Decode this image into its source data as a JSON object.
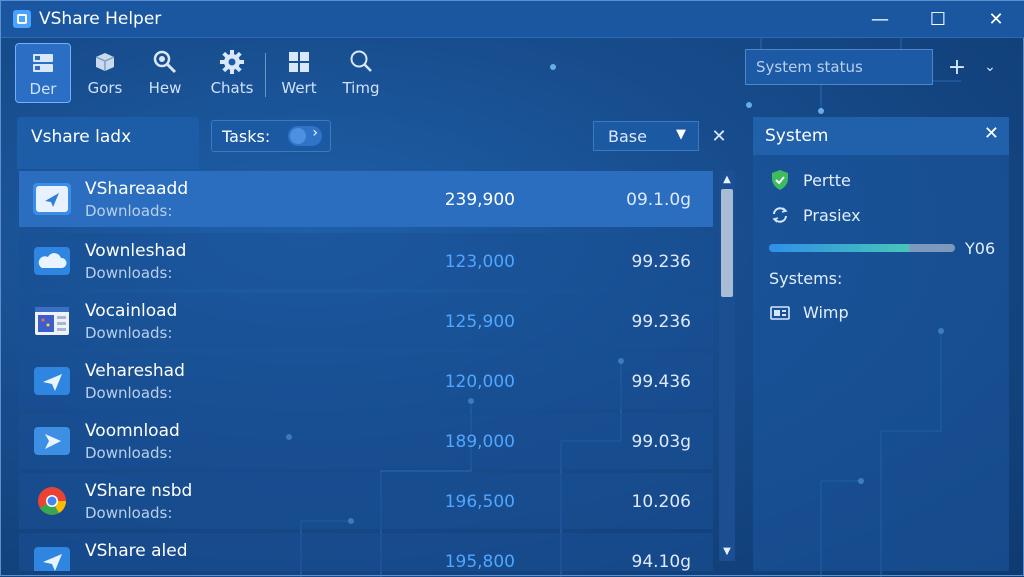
{
  "window": {
    "title": "VShare Helper",
    "minimize": "—",
    "maximize": "☐",
    "close": "✕"
  },
  "toolbar": {
    "items": [
      {
        "label": "Der",
        "icon": "drive-icon"
      },
      {
        "label": "Gors",
        "icon": "package-icon"
      },
      {
        "label": "Hew",
        "icon": "magnifier-icon"
      },
      {
        "label": "Chats",
        "icon": "gear-icon"
      },
      {
        "label": "Wert",
        "icon": "grid-icon"
      },
      {
        "label": "Timg",
        "icon": "search-icon"
      }
    ],
    "status_placeholder": "System status",
    "plus": "+",
    "caret": "⌄"
  },
  "left_tab": {
    "label": "Vshare ladx"
  },
  "tasks": {
    "label": "Tasks:"
  },
  "base": {
    "label": "Base",
    "caret": "▼",
    "close": "✕"
  },
  "downloads": [
    {
      "name": "VShareaadd",
      "sub": "Downloads:",
      "count": "239,900",
      "size": "09.1.0g",
      "icon": "send-icon",
      "selected": true
    },
    {
      "name": "Vownleshad",
      "sub": "Downloads:",
      "count": "123,000",
      "size": "99.236",
      "icon": "cloud-icon"
    },
    {
      "name": "Vocainload",
      "sub": "Downloads:",
      "count": "125,900",
      "size": "99.236",
      "icon": "app-window-icon"
    },
    {
      "name": "Vehareshad",
      "sub": "Downloads:",
      "count": "120,000",
      "size": "99.436",
      "icon": "send-icon"
    },
    {
      "name": "Voomnload",
      "sub": "Downloads:",
      "count": "189,000",
      "size": "99.03g",
      "icon": "navigate-icon"
    },
    {
      "name": "VShare nsbd",
      "sub": "Downloads:",
      "count": "196,500",
      "size": "10.206",
      "icon": "chrome-icon"
    },
    {
      "name": "VShare aled",
      "sub": "",
      "count": "195,800",
      "size": "94.10g",
      "icon": "send-icon"
    }
  ],
  "scroll": {
    "up": "▲",
    "down": "▼"
  },
  "system_panel": {
    "title": "System",
    "close": "✕",
    "items": [
      {
        "label": "Pertte",
        "icon": "shield-icon"
      },
      {
        "label": "Prasiex",
        "icon": "sync-icon"
      }
    ],
    "progress": {
      "value": 0.75,
      "label": "Y06"
    },
    "section": "Systems:",
    "sub_items": [
      {
        "label": "Wimp",
        "icon": "device-icon"
      }
    ]
  }
}
